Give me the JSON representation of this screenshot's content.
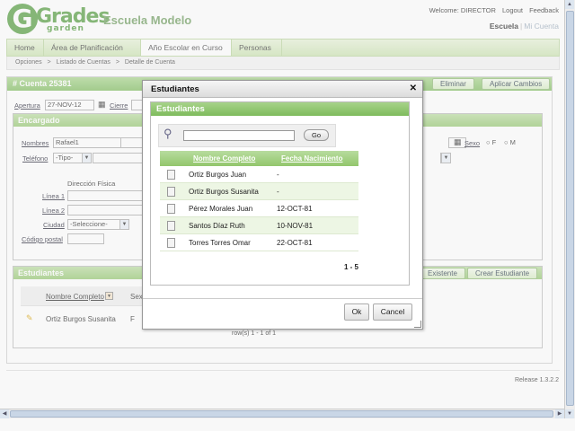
{
  "header": {
    "logo_main": "Grades",
    "logo_sub": "garden",
    "school_name": "Escuela Modelo",
    "welcome": "Welcome: DIRECTOR",
    "logout": "Logout",
    "feedback": "Feedback",
    "switch_active": "Escuela",
    "switch_inactive": "Mi Cuenta"
  },
  "nav": {
    "tabs": [
      {
        "label": "Home"
      },
      {
        "label": "Área de Planificación"
      },
      {
        "label": "Año Escolar en Curso"
      },
      {
        "label": "Personas"
      }
    ],
    "active_tab": "Año Escolar en Curso"
  },
  "breadcrumb": [
    "Opciones",
    ">",
    "Listado de Cuentas",
    ">",
    "Detalle de Cuenta"
  ],
  "account": {
    "title": "# Cuenta 25381",
    "delete_label": "Eliminar",
    "apply_label": "Aplicar Cambios",
    "apertura_label": "Apertura",
    "apertura_value": "27-NOV-12",
    "cierre_label": "Cierre"
  },
  "encargado": {
    "title": "Encargado",
    "nombres_label": "Nombres",
    "nombres_value": "Rafael1",
    "telefono_label": "Teléfono",
    "telefono_value": "-Tipo-",
    "direccion_title": "Dirección Física",
    "linea1_label": "Línea 1",
    "linea2_label": "Línea 2",
    "ciudad_label": "Ciudad",
    "ciudad_value": "-Seleccione-",
    "codigo_label": "Código postal",
    "sexo_label": "Sexo",
    "sexo_f": "F",
    "sexo_m": "M"
  },
  "students_section": {
    "title": "Estudiantes",
    "existente_label": "Existente",
    "crear_label": "Crear Estudiante",
    "col_nombre": "Nombre Completo",
    "col_sexo": "Sexo",
    "row_name": "Ortiz Burgos Susanita",
    "row_sexo": "F",
    "row_count": "row(s) 1 - 1 of 1"
  },
  "dialog": {
    "title": "Estudiantes",
    "inner_title": "Estudiantes",
    "search_placeholder": "",
    "go_label": "Go",
    "col_nombre": "Nombre Completo",
    "col_fecha": "Fecha Nacimiento",
    "rows": [
      {
        "nombre": "Ortiz Burgos Juan",
        "fecha": "-"
      },
      {
        "nombre": "Ortiz Burgos Susanita",
        "fecha": "-"
      },
      {
        "nombre": "Pérez Morales Juan",
        "fecha": "12-OCT-81"
      },
      {
        "nombre": "Santos Díaz Ruth",
        "fecha": "10-NOV-81"
      },
      {
        "nombre": "Torres Torres Omar",
        "fecha": "22-OCT-81"
      }
    ],
    "pager": "1 - 5",
    "ok_label": "Ok",
    "cancel_label": "Cancel"
  },
  "release": "Release 1.3.2.2"
}
